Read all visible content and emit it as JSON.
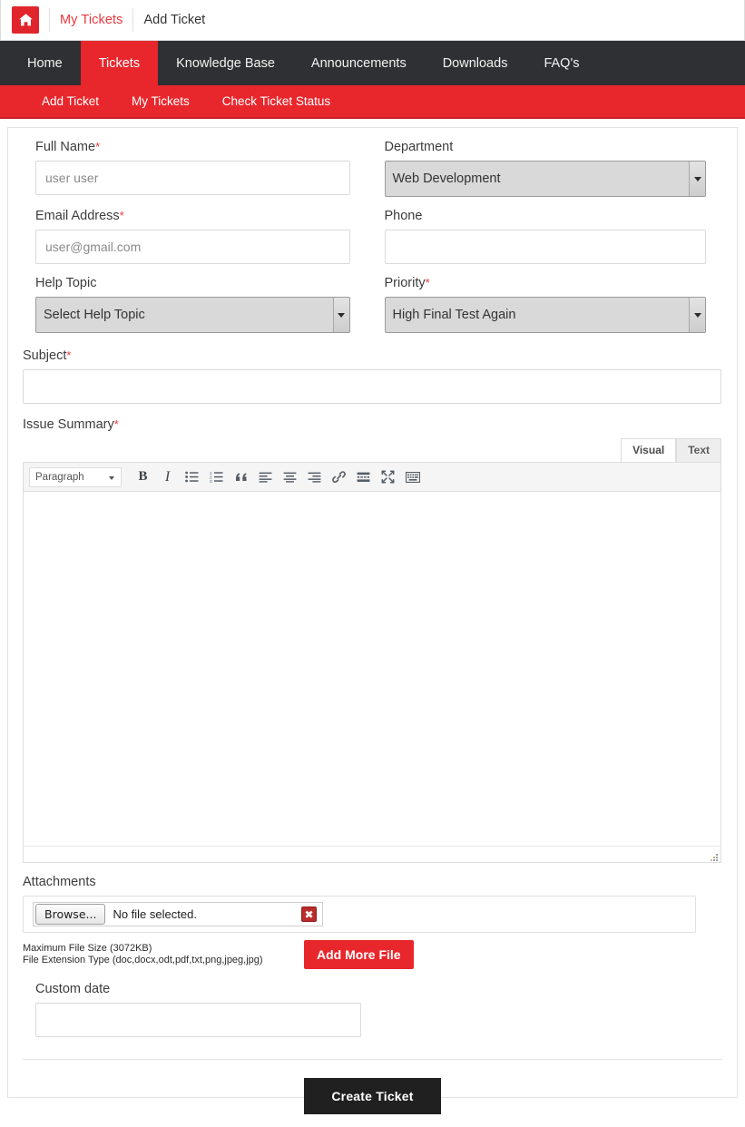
{
  "breadcrumb": {
    "home_icon": "home-icon",
    "my_tickets_label": "My Tickets",
    "current_label": "Add Ticket"
  },
  "main_nav": {
    "items": [
      {
        "label": "Home",
        "active": false
      },
      {
        "label": "Tickets",
        "active": true
      },
      {
        "label": "Knowledge Base",
        "active": false
      },
      {
        "label": "Announcements",
        "active": false
      },
      {
        "label": "Downloads",
        "active": false
      },
      {
        "label": "FAQ's",
        "active": false
      }
    ]
  },
  "sub_nav": {
    "items": [
      {
        "label": "Add Ticket"
      },
      {
        "label": "My Tickets"
      },
      {
        "label": "Check Ticket Status"
      }
    ]
  },
  "form": {
    "full_name": {
      "label": "Full Name",
      "required": "*",
      "value": "",
      "placeholder": "user user"
    },
    "department": {
      "label": "Department",
      "required": "",
      "selected": "Web Development",
      "options": [
        "Web Development"
      ]
    },
    "email": {
      "label": "Email Address",
      "required": "*",
      "value": "",
      "placeholder": "user@gmail.com"
    },
    "phone": {
      "label": "Phone",
      "required": "",
      "value": "",
      "placeholder": ""
    },
    "help_topic": {
      "label": "Help Topic",
      "required": "",
      "selected": "Select Help Topic",
      "options": [
        "Select Help Topic"
      ]
    },
    "priority": {
      "label": "Priority",
      "required": "*",
      "selected": "High Final Test Again",
      "options": [
        "High Final Test Again"
      ]
    },
    "subject": {
      "label": "Subject",
      "required": "*",
      "value": "",
      "placeholder": ""
    },
    "issue_summary": {
      "label": "Issue Summary",
      "required": "*",
      "value": ""
    },
    "attachments": {
      "label": "Attachments",
      "browse_label": "Browse...",
      "file_status": "No file selected.",
      "remove_icon": "delete-x-icon",
      "max_size_note": "Maximum File Size (3072KB)",
      "extension_note": "File Extension Type (doc,docx,odt,pdf,txt,png,jpeg,jpg)",
      "add_more_label": "Add More File"
    },
    "custom_date": {
      "label": "Custom date",
      "value": "",
      "placeholder": ""
    },
    "submit_label": "Create Ticket"
  },
  "editor": {
    "tabs": [
      {
        "label": "Visual",
        "active": true
      },
      {
        "label": "Text",
        "active": false
      }
    ],
    "format_select": "Paragraph",
    "toolbar": [
      {
        "name": "bold-icon",
        "title": "Bold"
      },
      {
        "name": "italic-icon",
        "title": "Italic"
      },
      {
        "name": "bulleted-list-icon",
        "title": "Bulleted list"
      },
      {
        "name": "numbered-list-icon",
        "title": "Numbered list"
      },
      {
        "name": "blockquote-icon",
        "title": "Blockquote"
      },
      {
        "name": "align-left-icon",
        "title": "Align left"
      },
      {
        "name": "align-center-icon",
        "title": "Align center"
      },
      {
        "name": "align-right-icon",
        "title": "Align right"
      },
      {
        "name": "link-icon",
        "title": "Insert link"
      },
      {
        "name": "read-more-icon",
        "title": "Insert Read More tag"
      },
      {
        "name": "fullscreen-icon",
        "title": "Distraction-free writing mode"
      },
      {
        "name": "toolbar-toggle-icon",
        "title": "Toolbar Toggle"
      }
    ]
  },
  "colors": {
    "brand_red": "#e8272d",
    "nav_dark": "#2f3033",
    "submit_dark": "#202020",
    "label_text": "#3c3c3c",
    "required_red": "#e8383d"
  }
}
